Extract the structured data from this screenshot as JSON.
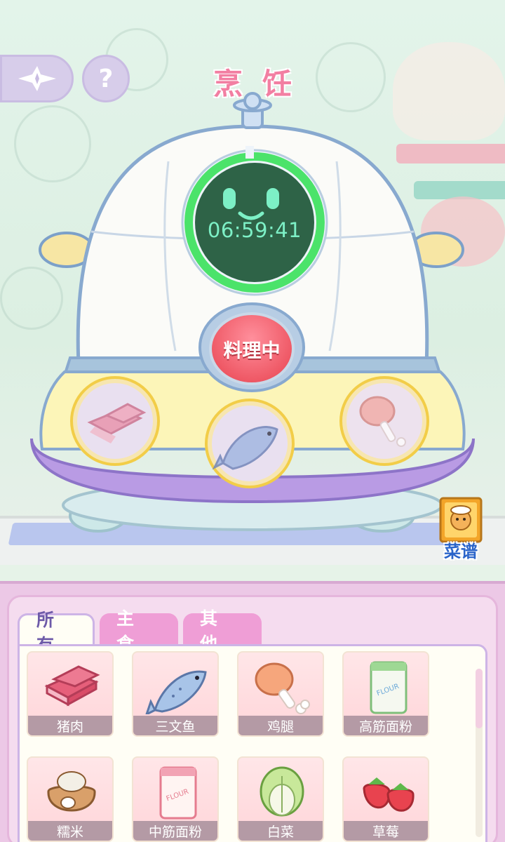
{
  "header": {
    "title": "烹饪",
    "back_icon": "sparkle-back-icon",
    "help_label": "?"
  },
  "cooker": {
    "timer": "06:59:41",
    "status_button": "料理中",
    "slots": [
      "pork-icon",
      "salmon-icon",
      "chicken-leg-icon"
    ],
    "progress_ring_color": "#4be36a"
  },
  "recipe_book": {
    "label": "菜谱"
  },
  "inventory": {
    "tabs": [
      {
        "label": "所有",
        "active": true
      },
      {
        "label": "主食",
        "active": false
      },
      {
        "label": "其他",
        "active": false
      }
    ],
    "items": [
      {
        "label": "猪肉",
        "icon": "pork-icon"
      },
      {
        "label": "三文鱼",
        "icon": "salmon-icon"
      },
      {
        "label": "鸡腿",
        "icon": "chicken-leg-icon"
      },
      {
        "label": "高筋面粉",
        "icon": "flour-bag-icon"
      },
      {
        "label": "糯米",
        "icon": "rice-sack-icon"
      },
      {
        "label": "中筋面粉",
        "icon": "flour-bag-icon"
      },
      {
        "label": "白菜",
        "icon": "cabbage-icon"
      },
      {
        "label": "草莓",
        "icon": "strawberry-icon"
      }
    ]
  },
  "colors": {
    "accent_pink": "#f27fa2",
    "panel_pink": "#ecc8e6",
    "tab_pink": "#ef9ed6",
    "cook_red": "#ef5966"
  }
}
